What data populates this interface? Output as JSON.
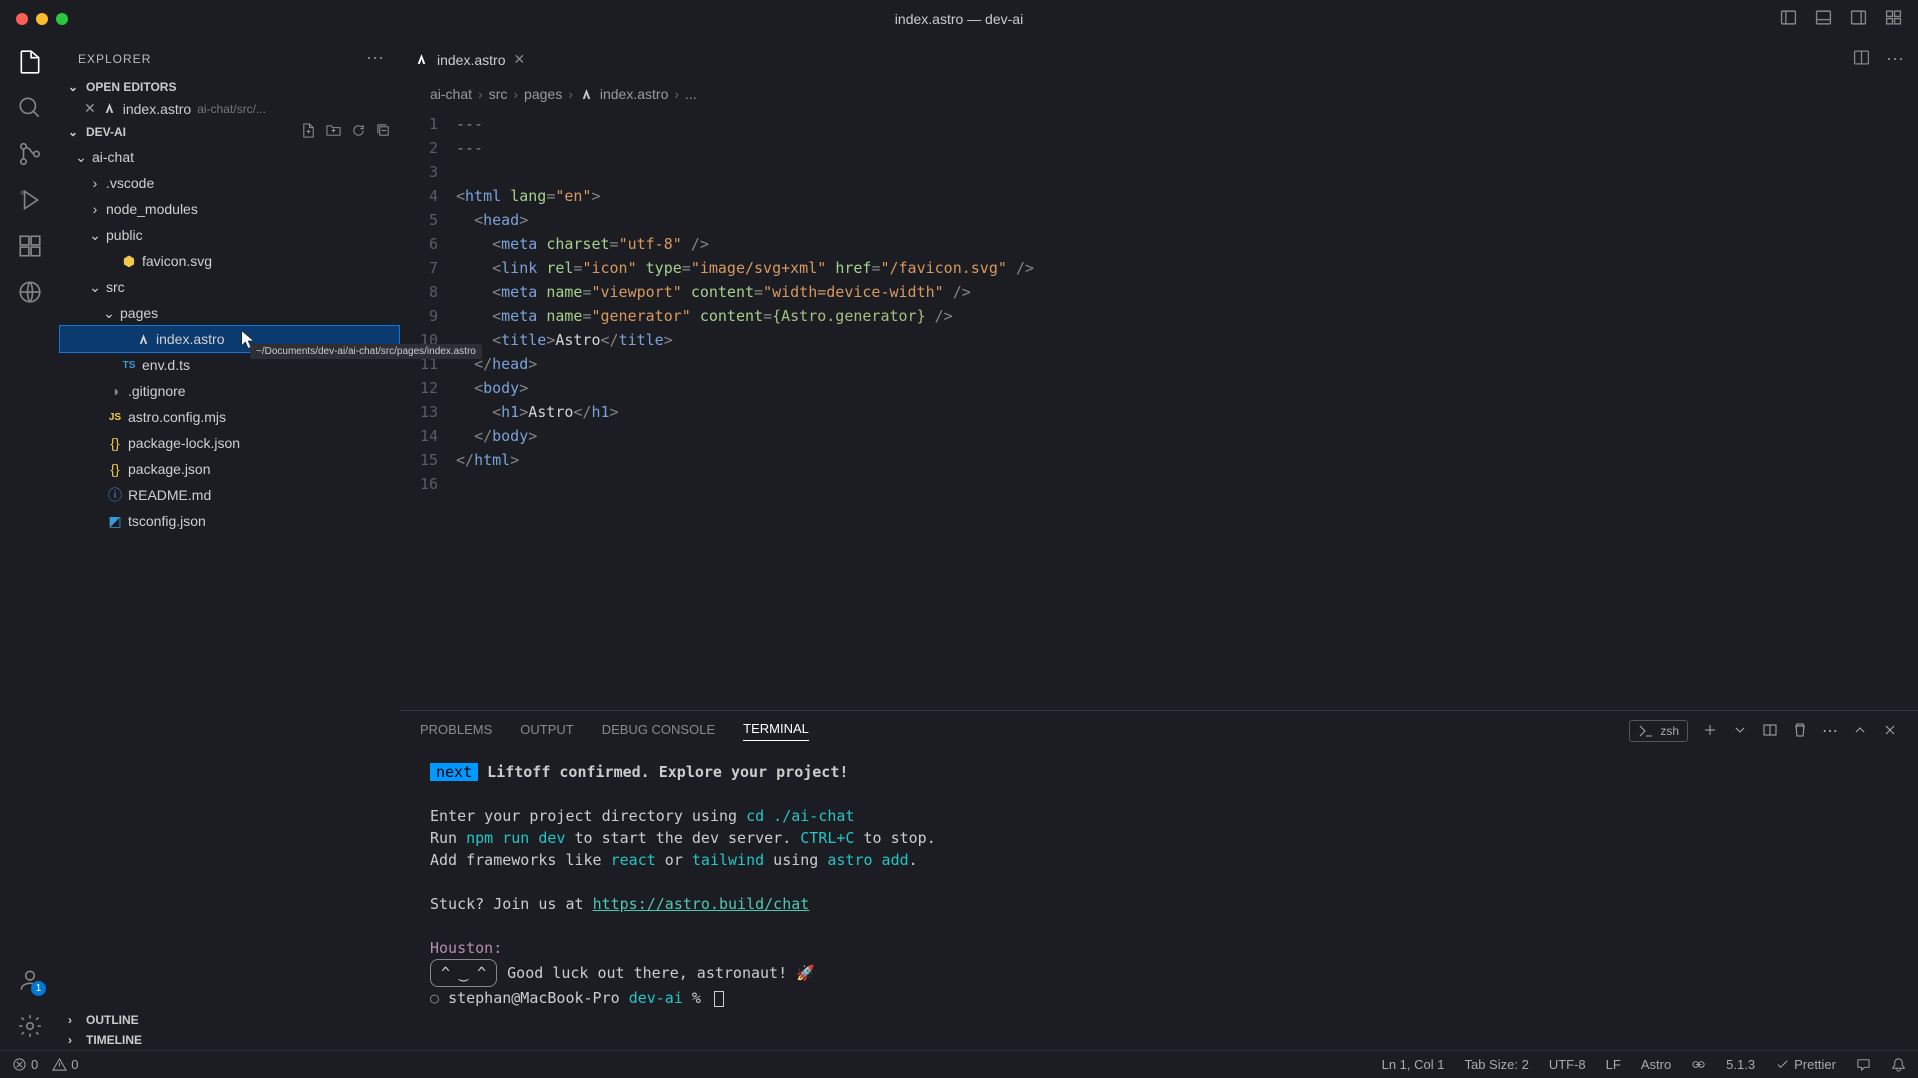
{
  "window": {
    "title": "index.astro — dev-ai"
  },
  "sidebar": {
    "title": "EXPLORER",
    "openEditors": {
      "label": "OPEN EDITORS",
      "item": {
        "name": "index.astro",
        "path": "ai-chat/src/..."
      }
    },
    "workspace": "DEV-AI",
    "tree": {
      "aichat": "ai-chat",
      "vscode": ".vscode",
      "node_modules": "node_modules",
      "public": "public",
      "favicon": "favicon.svg",
      "src": "src",
      "pages": "pages",
      "indexastro": "index.astro",
      "envdts": "env.d.ts",
      "gitignore": ".gitignore",
      "astroconfig": "astro.config.mjs",
      "pkglock": "package-lock.json",
      "pkg": "package.json",
      "readme": "README.md",
      "tsconfig": "tsconfig.json"
    },
    "outline": "OUTLINE",
    "timeline": "TIMELINE",
    "tooltip": "~/Documents/dev-ai/ai-chat/src/pages/index.astro"
  },
  "tab": {
    "name": "index.astro"
  },
  "breadcrumb": {
    "p1": "ai-chat",
    "p2": "src",
    "p3": "pages",
    "p4": "index.astro",
    "p5": "..."
  },
  "code": {
    "lines": [
      "1",
      "2",
      "3",
      "4",
      "5",
      "6",
      "7",
      "8",
      "9",
      "10",
      "11",
      "12",
      "13",
      "14",
      "15",
      "16"
    ]
  },
  "panel": {
    "problems": "PROBLEMS",
    "output": "OUTPUT",
    "debug": "DEBUG CONSOLE",
    "terminal": "TERMINAL",
    "shell": "zsh"
  },
  "terminal": {
    "next": "next",
    "liftoff": "Liftoff confirmed. Explore your project!",
    "enter": "Enter your project directory using ",
    "cd": "cd ./ai-chat",
    "run1": "Run ",
    "npm": "npm run dev",
    "run2": " to start the dev server. ",
    "ctrlc": "CTRL+C",
    "run3": " to stop.",
    "add1": "Add frameworks like ",
    "react": "react",
    "or": " or ",
    "tailwind": "tailwind",
    "using": " using ",
    "astroadd": "astro add",
    "dot": ".",
    "stuck": "Stuck? Join us at ",
    "link": "https://astro.build/chat",
    "houston": "Houston:",
    "face": "^ ‿ ^",
    "goodluck": "Good luck out there, astronaut! 🚀",
    "prompt_user": "stephan@MacBook-Pro",
    "prompt_dir": "dev-ai",
    "prompt_sym": "%"
  },
  "statusbar": {
    "errors": "0",
    "warnings": "0",
    "lncol": "Ln 1, Col 1",
    "tabsize": "Tab Size: 2",
    "encoding": "UTF-8",
    "eol": "LF",
    "lang": "Astro",
    "version": "5.1.3",
    "prettier": "Prettier"
  },
  "accountBadge": "1"
}
